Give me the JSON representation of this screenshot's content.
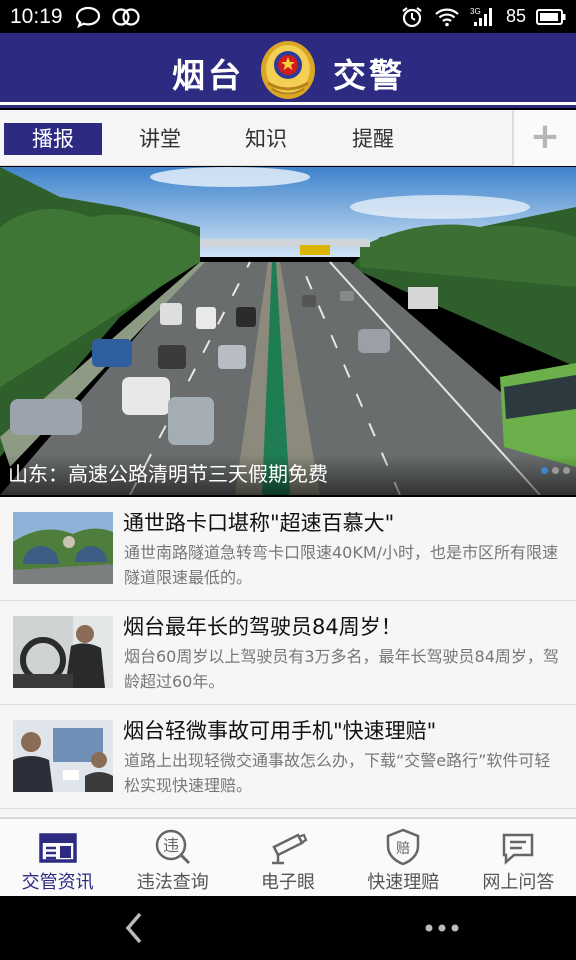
{
  "status_bar": {
    "time": "10:19",
    "battery": "85",
    "network": "3G"
  },
  "header": {
    "title_left": "烟台",
    "title_right": "交警"
  },
  "tabs": [
    {
      "label": "播报",
      "active": true
    },
    {
      "label": "讲堂",
      "active": false
    },
    {
      "label": "知识",
      "active": false
    },
    {
      "label": "提醒",
      "active": false
    }
  ],
  "tab_add": "+",
  "banner": {
    "caption": "山东：高速公路清明节三天假期免费",
    "slides": 3,
    "current_slide": 1
  },
  "news": [
    {
      "title": "通世路卡口堪称\"超速百慕大\"",
      "summary": "通世南路隧道急转弯卡口限速40KM/小时，也是市区所有限速隧道限速最低的。"
    },
    {
      "title": "烟台最年长的驾驶员84周岁！",
      "summary": "烟台60周岁以上驾驶员有3万多名，最年长驾驶员84周岁，驾龄超过60年。"
    },
    {
      "title": "烟台轻微事故可用手机\"快速理赔\"",
      "summary": "道路上出现轻微交通事故怎么办，下载“交警e路行”软件可轻松实现快速理赔。"
    }
  ],
  "bottom_nav": [
    {
      "label": "交管资讯",
      "icon": "news-icon",
      "active": true
    },
    {
      "label": "违法查询",
      "icon": "violation-icon",
      "active": false
    },
    {
      "label": "电子眼",
      "icon": "camera-icon",
      "active": false
    },
    {
      "label": "快速理赔",
      "icon": "claim-shield-icon",
      "active": false
    },
    {
      "label": "网上问答",
      "icon": "chat-icon",
      "active": false
    }
  ],
  "colors": {
    "brand": "#2d2a82",
    "accent_dot": "#3a86d0"
  }
}
